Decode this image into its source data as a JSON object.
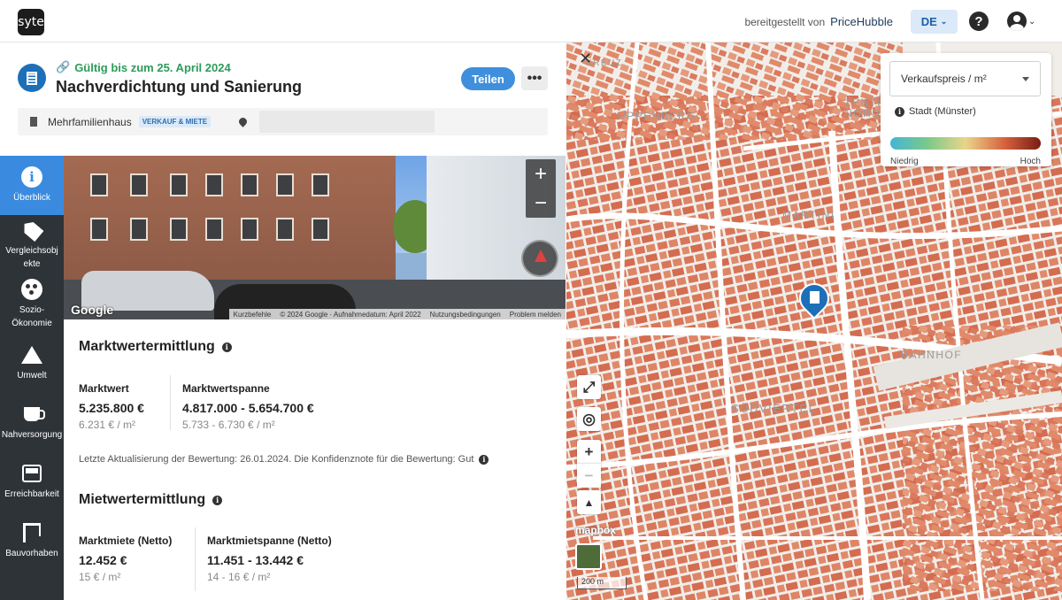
{
  "topbar": {
    "logo": "syte",
    "powered_by": "bereitgestellt von",
    "provider": "PriceHubble",
    "language": "DE"
  },
  "header": {
    "valid_until": "Gültig bis zum 25. April 2024",
    "title": "Nachverdichtung und Sanierung",
    "share_label": "Teilen",
    "more_label": "•••",
    "property_type": "Mehrfamilienhaus",
    "property_badge": "VERKAUF & MIETE"
  },
  "sidebar": {
    "items": [
      {
        "label": "Überblick",
        "icon": "info-icon"
      },
      {
        "label": "Vergleichsobjekte",
        "icon": "tag-icon"
      },
      {
        "label": "Sozio-Ökonomie",
        "icon": "demographics-icon"
      },
      {
        "label": "Umwelt",
        "icon": "mountain-icon"
      },
      {
        "label": "Nahversorgung",
        "icon": "coffee-icon"
      },
      {
        "label": "Erreichbarkeit",
        "icon": "transport-icon"
      },
      {
        "label": "Bauvorhaben",
        "icon": "crane-icon"
      }
    ]
  },
  "streetview": {
    "zoom_in": "+",
    "zoom_out": "−",
    "watermark": "Google",
    "credits": [
      "Kurzbefehle",
      "© 2024 Google · Aufnahmedatum: April 2022",
      "Nutzungsbedingungen",
      "Problem melden"
    ]
  },
  "valuation": {
    "title": "Marktwertermittlung",
    "value_label": "Marktwert",
    "value": "5.235.800 €",
    "value_per_m2": "6.231 € / m²",
    "range_label": "Marktwertspanne",
    "range": "4.817.000 - 5.654.700 €",
    "range_per_m2": "5.733 - 6.730 € / m²",
    "note": "Letzte Aktualisierung der Bewertung: 26.01.2024. Die Konfidenznote für die Bewertung: Gut"
  },
  "rent": {
    "title": "Mietwertermittlung",
    "value_label": "Marktmiete (Netto)",
    "value": "12.452 €",
    "value_per_m2": "15 € / m²",
    "range_label": "Marktmietspanne (Netto)",
    "range": "11.451 - 13.442 €",
    "range_per_m2": "14 - 16 € / m²"
  },
  "map": {
    "legend_select": "Verkaufspreis / m²",
    "legend_scope": "Stadt (Münster)",
    "legend_low": "Niedrig",
    "legend_high": "Hoch",
    "labels": [
      "UPPENBERG",
      "ZENTRUM NORD",
      "MARTINI",
      "BAHNHOF",
      "SÜDVIERTEL",
      "KREUZ"
    ],
    "attribution": "mapbox",
    "scale": "200 m",
    "colors": {
      "building": "#d9765a",
      "road": "#ffffff",
      "ground": "#f1eeea"
    }
  }
}
